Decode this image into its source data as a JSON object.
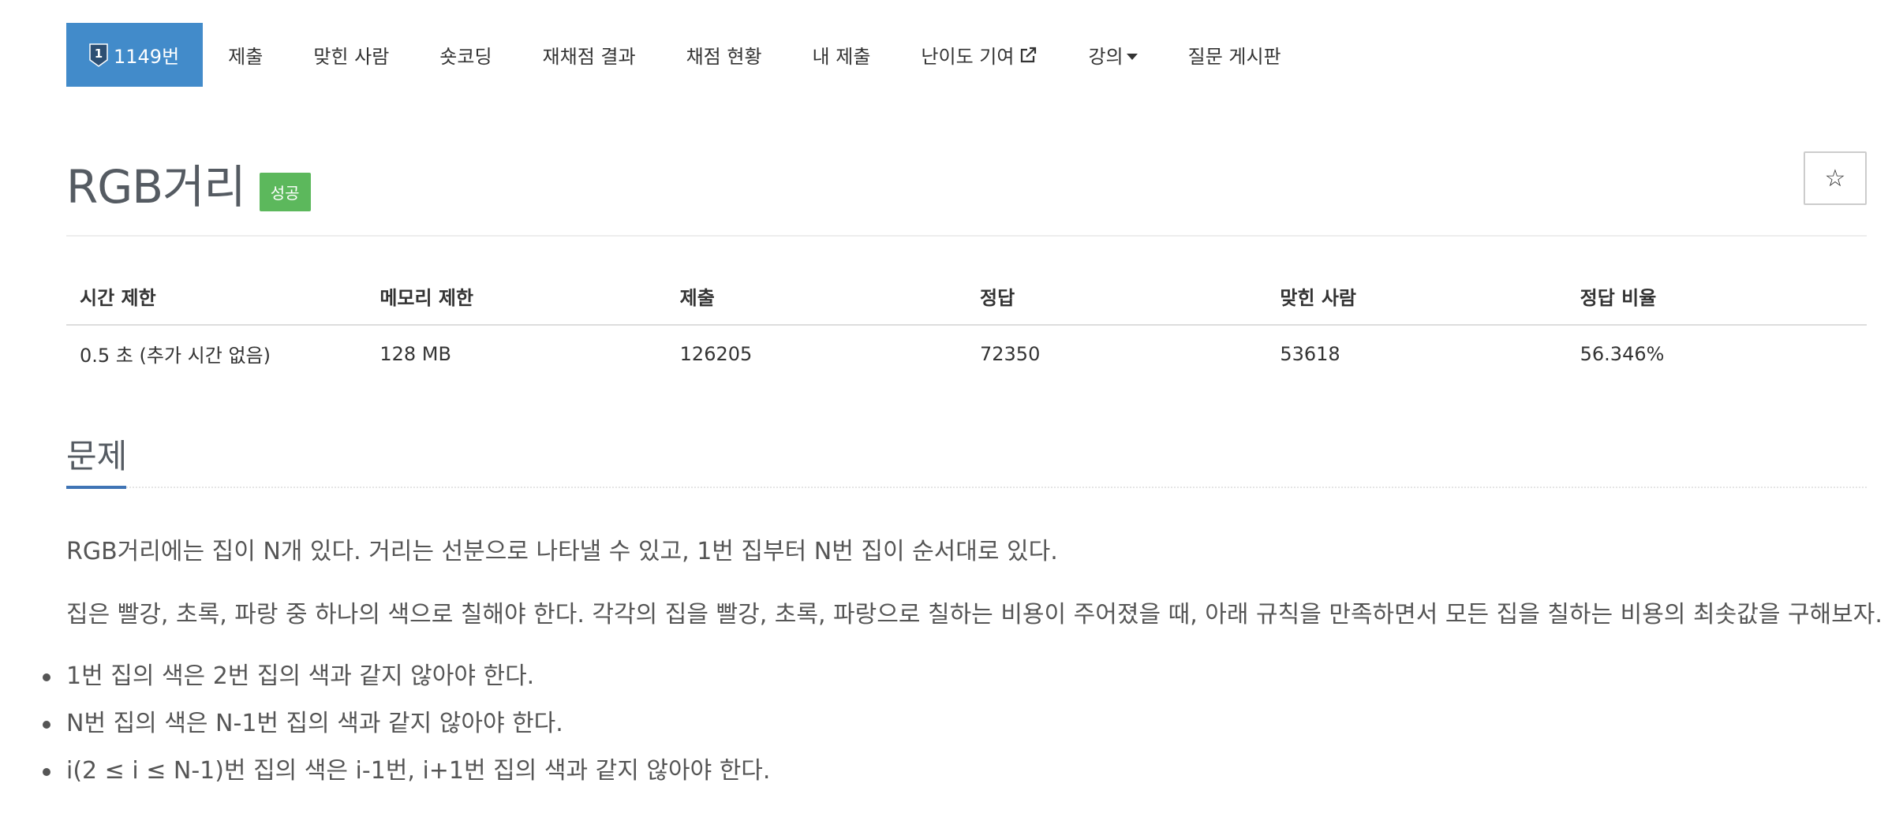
{
  "nav": {
    "problem_id_label": "1149번",
    "tier_number": "1",
    "items": [
      {
        "label": "제출"
      },
      {
        "label": "맞힌 사람"
      },
      {
        "label": "숏코딩"
      },
      {
        "label": "재채점 결과"
      },
      {
        "label": "채점 현황"
      },
      {
        "label": "내 제출"
      },
      {
        "label": "난이도 기여"
      },
      {
        "label": "강의"
      },
      {
        "label": "질문 게시판"
      }
    ],
    "active_color": "#428bca"
  },
  "problem": {
    "title": "RGB거리",
    "status_badge": "성공",
    "star_icon": "☆"
  },
  "info_table": {
    "headers": [
      "시간 제한",
      "메모리 제한",
      "제출",
      "정답",
      "맞힌 사람",
      "정답 비율"
    ],
    "values": [
      "0.5 초 (추가 시간 없음)",
      "128 MB",
      "126205",
      "72350",
      "53618",
      "56.346%"
    ]
  },
  "section": {
    "title": "문제",
    "paragraphs": [
      "RGB거리에는 집이 N개 있다. 거리는 선분으로 나타낼 수 있고, 1번 집부터 N번 집이 순서대로 있다.",
      "집은 빨강, 초록, 파랑 중 하나의 색으로 칠해야 한다. 각각의 집을 빨강, 초록, 파랑으로 칠하는 비용이 주어졌을 때, 아래 규칙을 만족하면서 모든 집을 칠하는 비용의 최솟값을 구해보자."
    ],
    "rules": [
      "1번 집의 색은 2번 집의 색과 같지 않아야 한다.",
      "N번 집의 색은 N-1번 집의 색과 같지 않아야 한다.",
      "i(2 ≤ i ≤ N-1)번 집의 색은 i-1번, i+1번 집의 색과 같지 않아야 한다."
    ]
  }
}
